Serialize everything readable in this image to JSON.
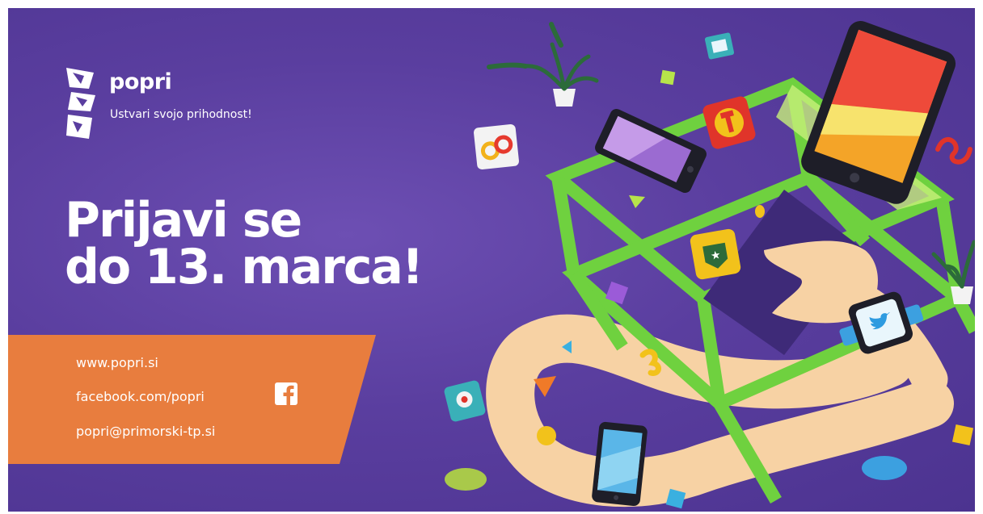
{
  "brand": {
    "name": "popri",
    "tagline": "Ustvari svojo prihodnost!",
    "logo_text": "POPRI"
  },
  "headline": {
    "line1": "Prijavi se",
    "line2": "do 13. marca!"
  },
  "contact": {
    "website": "www.popri.si",
    "facebook": "facebook.com/popri",
    "email": "popri@primorski-tp.si"
  },
  "icons": {
    "facebook": "facebook-icon",
    "twitter": "twitter-icon",
    "settings": "gears-icon",
    "tools": "wrench-icon",
    "badge": "star-badge-icon",
    "location": "map-pin-icon"
  },
  "colors": {
    "background": "#5a3e9f",
    "banner": "#e87d3e",
    "frame": "#6fd13f",
    "text": "#ffffff"
  }
}
